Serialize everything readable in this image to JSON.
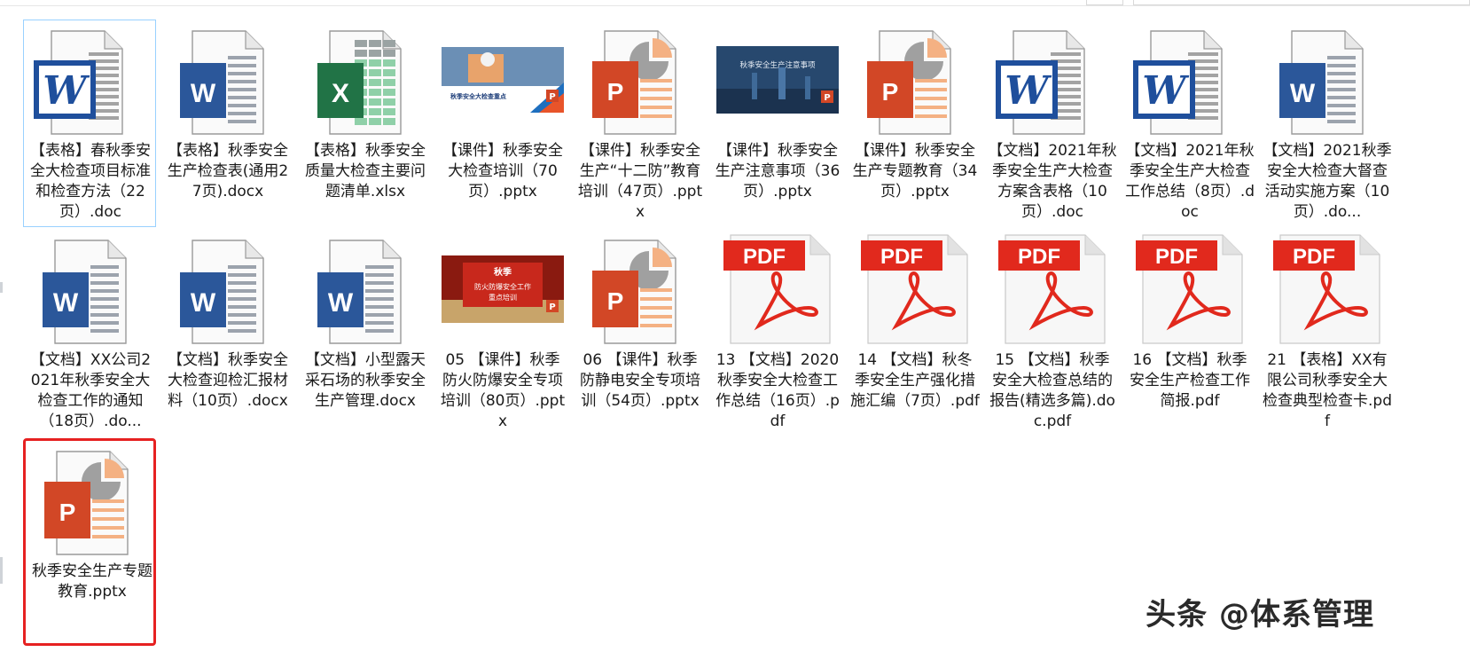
{
  "window": {
    "colors": {
      "selection_outline": "#e62121",
      "focus_outline": "#99d1ff"
    }
  },
  "files": [
    {
      "label": "【表格】春秋季安全大检查项目标准和检查方法（22页）.doc",
      "type": "word-classic",
      "icon": "word-classic-icon",
      "focused": true
    },
    {
      "label": "【表格】秋季安全生产检查表(通用27页).docx",
      "type": "word",
      "icon": "word-doc-icon"
    },
    {
      "label": "【表格】秋季安全质量大检查主要问题清单.xlsx",
      "type": "excel",
      "icon": "excel-sheet-icon"
    },
    {
      "label": "【课件】秋季安全大检查培训（70页）.pptx",
      "type": "ppt-thumb-a",
      "icon": "slide-thumbnail",
      "thumb_text": "秋季安全大检查重点"
    },
    {
      "label": "【课件】秋季安全生产“十二防”教育培训（47页）.pptx",
      "type": "ppt",
      "icon": "powerpoint-icon"
    },
    {
      "label": "【课件】秋季安全生产注意事项（36页）.pptx",
      "type": "ppt-thumb-b",
      "icon": "slide-thumbnail",
      "thumb_text": "秋季安全生产注意事项"
    },
    {
      "label": "【课件】秋季安全生产专题教育（34页）.pptx",
      "type": "ppt",
      "icon": "powerpoint-icon"
    },
    {
      "label": "【文档】2021年秋季安全生产大检查方案含表格（10页）.doc",
      "type": "word-classic",
      "icon": "word-classic-icon"
    },
    {
      "label": "【文档】2021年秋季安全生产大检查工作总结（8页）.doc",
      "type": "word-classic",
      "icon": "word-classic-icon"
    },
    {
      "label": "【文档】2021秋季安全大检查大督查活动实施方案（10页）.do...",
      "type": "word",
      "icon": "word-doc-icon"
    },
    {
      "label": "【文档】XX公司2021年秋季安全大检查工作的通知（18页）.do...",
      "type": "word",
      "icon": "word-doc-icon"
    },
    {
      "label": "【文档】秋季安全大检查迎检汇报材料（10页）.docx",
      "type": "word",
      "icon": "word-doc-icon"
    },
    {
      "label": "【文档】小型露天采石场的秋季安全生产管理.docx",
      "type": "word",
      "icon": "word-doc-icon"
    },
    {
      "label": "05 【课件】秋季防火防爆安全专项培训（80页）.pptx",
      "type": "ppt-thumb-c",
      "icon": "slide-thumbnail",
      "thumb_text": "秋季",
      "thumb_text2": "防火防爆安全工作",
      "thumb_text3": "重点培训"
    },
    {
      "label": "06 【课件】秋季防静电安全专项培训（54页）.pptx",
      "type": "ppt",
      "icon": "powerpoint-icon"
    },
    {
      "label": "13 【文档】2020秋季安全大检查工作总结（16页）.pdf",
      "type": "pdf",
      "icon": "pdf-icon",
      "badge": "PDF"
    },
    {
      "label": "14 【文档】秋冬季安全生产强化措施汇编（7页）.pdf",
      "type": "pdf",
      "icon": "pdf-icon",
      "badge": "PDF"
    },
    {
      "label": "15 【文档】秋季安全大检查总结的报告(精选多篇).doc.pdf",
      "type": "pdf",
      "icon": "pdf-icon",
      "badge": "PDF"
    },
    {
      "label": "16 【文档】秋季安全生产检查工作简报.pdf",
      "type": "pdf",
      "icon": "pdf-icon",
      "badge": "PDF"
    },
    {
      "label": "21 【表格】XX有限公司秋季安全大检查典型检查卡.pdf",
      "type": "pdf",
      "icon": "pdf-icon",
      "badge": "PDF"
    },
    {
      "label": "秋季安全生产专题教育.pptx",
      "type": "ppt",
      "icon": "powerpoint-icon",
      "selected": true
    }
  ],
  "watermark": "头条 @体系管理"
}
